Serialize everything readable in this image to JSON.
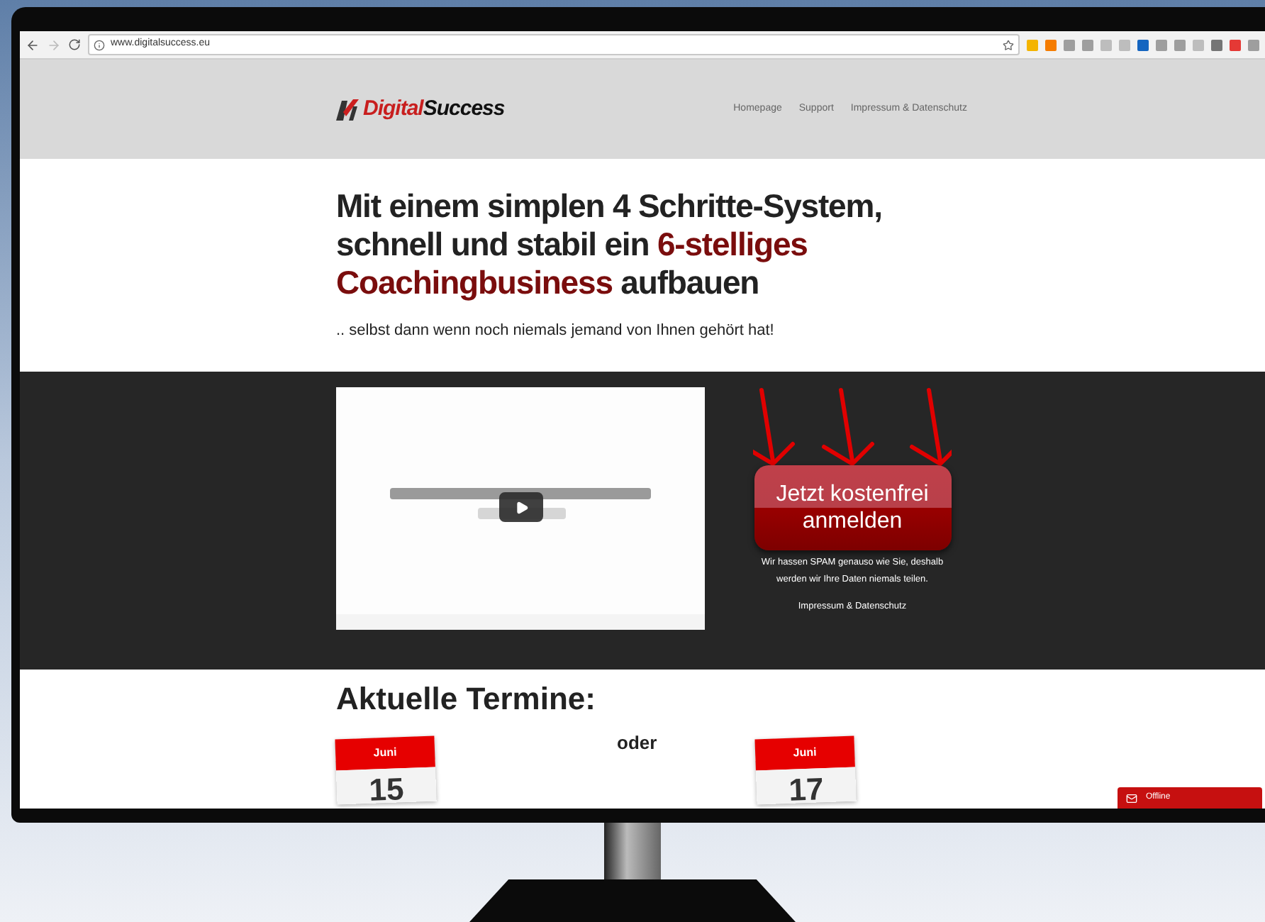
{
  "browser": {
    "url": "www.digitalsuccess.eu"
  },
  "header": {
    "logo": {
      "part_1": "Digital",
      "part_2": "Success"
    },
    "nav": [
      {
        "label": "Homepage"
      },
      {
        "label": "Support"
      },
      {
        "label": "Impressum & Datenschutz"
      }
    ]
  },
  "hero": {
    "headline": [
      [
        {
          "text": "Mit einem simplen 4 Schritte-System,",
          "highlight": false
        }
      ],
      [
        {
          "text": "schnell und stabil ein ",
          "highlight": false
        },
        {
          "text": "6-stelliges",
          "highlight": true
        }
      ],
      [
        {
          "text": "Coachingbusiness",
          "highlight": true
        },
        {
          "text": " aufbauen",
          "highlight": false
        }
      ]
    ],
    "subline": ".. selbst dann wenn noch niemals jemand von Ihnen gehört hat!"
  },
  "signup": {
    "button": {
      "line_1": "Jetzt kostenfrei",
      "line_2": "anmelden"
    },
    "note": "Wir hassen SPAM genauso wie Sie, deshalb werden wir Ihre Daten niemals teilen.",
    "link": "Impressum & Datenschutz"
  },
  "dates": {
    "heading": "Aktuelle Termine:",
    "separator": "oder",
    "items": [
      {
        "month": "Juni",
        "day": "15"
      },
      {
        "month": "Juni",
        "day": "17"
      }
    ]
  },
  "chat": {
    "label": "Offline"
  }
}
